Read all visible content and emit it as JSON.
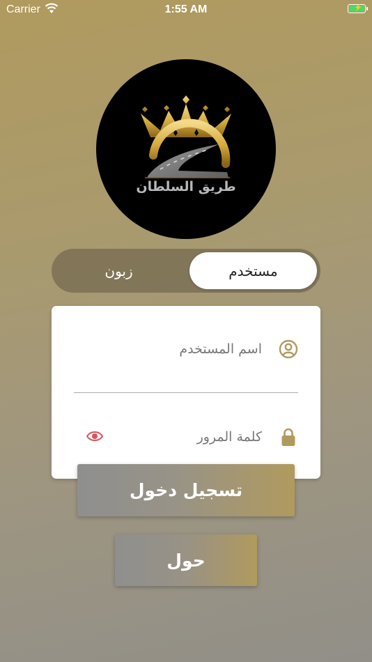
{
  "status_bar": {
    "carrier": "Carrier",
    "time": "1:55 AM",
    "battery_icon": "battery-charging-icon",
    "wifi_icon": "wifi-icon"
  },
  "logo": {
    "text": "طريق السلطان",
    "icon": "crown-road-logo"
  },
  "user_type": {
    "selected": "مستخدم",
    "other": "زبون"
  },
  "form": {
    "username_placeholder": "اسم المستخدم",
    "password_placeholder": "كلمة المرور",
    "username_icon": "user-circle-icon",
    "password_icon": "lock-icon",
    "toggle_icon": "eye-icon"
  },
  "buttons": {
    "login": "تسجيل دخول",
    "about": "حول"
  },
  "colors": {
    "accent": "#b09a5e",
    "eye": "#e0505a",
    "background_top": "#b09a5e",
    "background_bottom": "#918f88"
  }
}
